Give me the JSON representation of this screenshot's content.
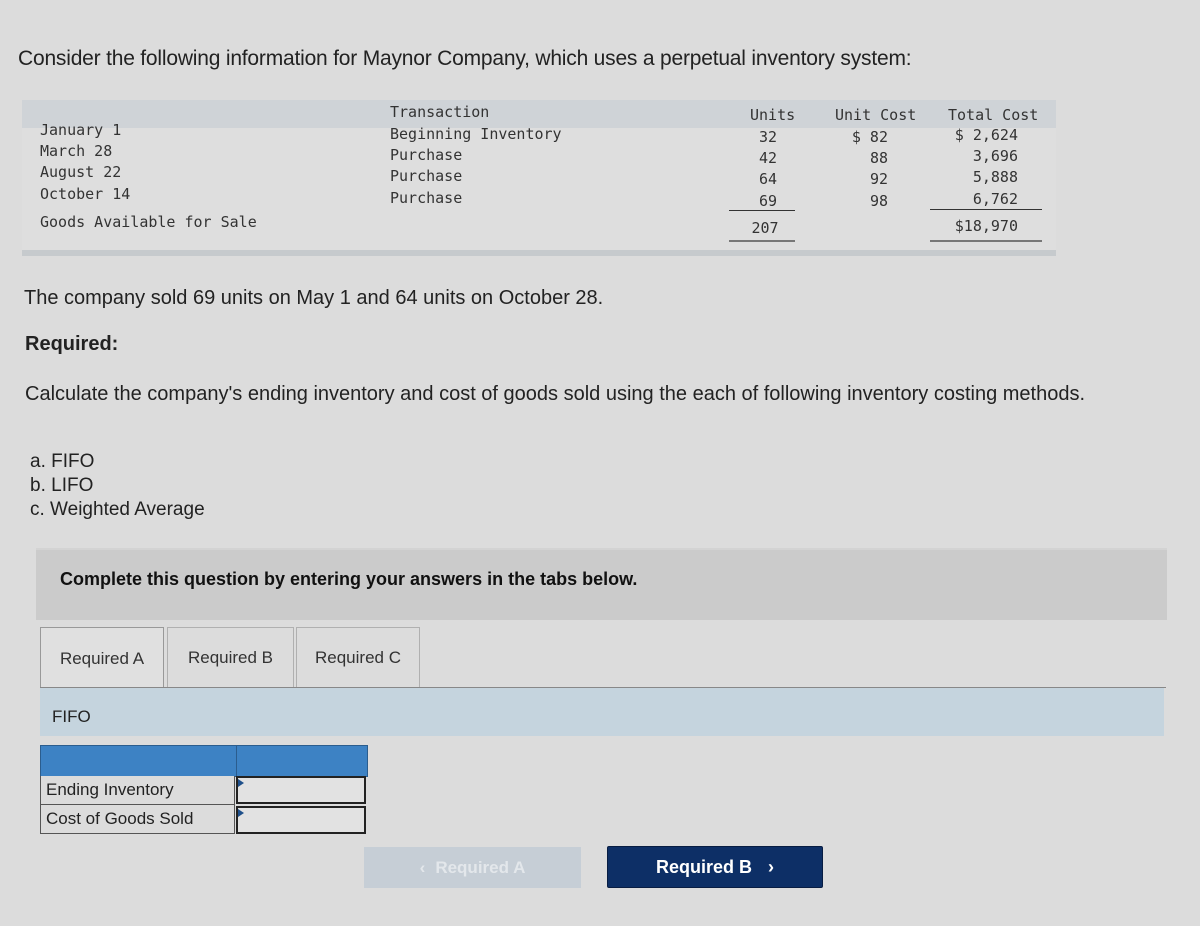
{
  "intro": "Consider the following information for Maynor Company, which uses a perpetual inventory system:",
  "inventory_table": {
    "headers": {
      "transaction": "Transaction",
      "units": "Units",
      "unit_cost": "Unit Cost",
      "total_cost": "Total Cost"
    },
    "rows": [
      {
        "date": "January 1",
        "transaction": "Beginning Inventory",
        "units": "32",
        "unit_cost": "$ 82",
        "total_cost": "$ 2,624"
      },
      {
        "date": "March 28",
        "transaction": "Purchase",
        "units": "42",
        "unit_cost": "88",
        "total_cost": "3,696"
      },
      {
        "date": "August 22",
        "transaction": "Purchase",
        "units": "64",
        "unit_cost": "92",
        "total_cost": "5,888"
      },
      {
        "date": "October 14",
        "transaction": "Purchase",
        "units": "69",
        "unit_cost": "98",
        "total_cost": "6,762"
      }
    ],
    "total": {
      "label": "Goods Available for Sale",
      "units": "207",
      "total_cost": "$18,970"
    }
  },
  "sold_text": "The company sold 69 units on May 1 and 64 units on October 28.",
  "required_heading": "Required:",
  "calc_text": "Calculate the company's ending inventory and cost of goods sold using the each of following inventory costing methods.",
  "methods": [
    "a. FIFO",
    "b. LIFO",
    "c. Weighted Average"
  ],
  "banner": "Complete this question by entering your answers in the tabs below.",
  "tabs": [
    {
      "label": "Required A",
      "active": true
    },
    {
      "label": "Required B",
      "active": false
    },
    {
      "label": "Required C",
      "active": false
    }
  ],
  "section_title": "FIFO",
  "answer_table": {
    "rows": [
      {
        "label": "Ending Inventory",
        "value": ""
      },
      {
        "label": "Cost of Goods Sold",
        "value": ""
      }
    ]
  },
  "nav": {
    "prev_label": "Required A",
    "prev_icon": "chevron-left-icon",
    "next_label": "Required B",
    "next_icon": "chevron-right-icon"
  }
}
